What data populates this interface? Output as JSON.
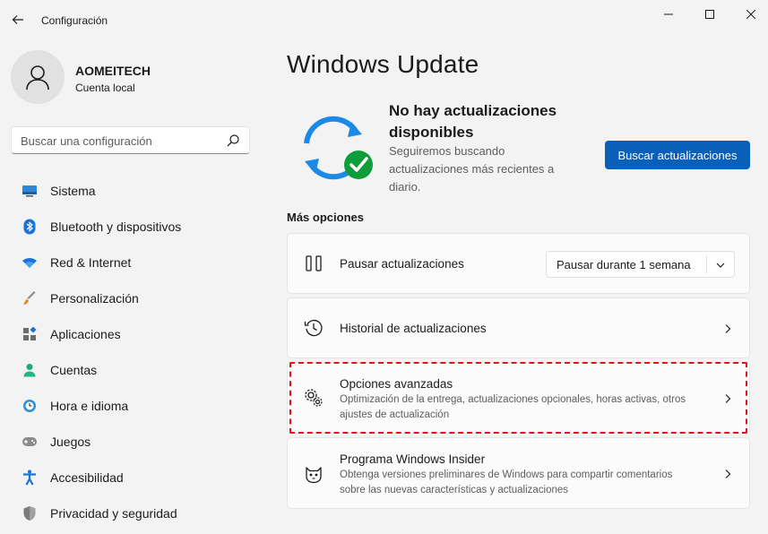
{
  "window": {
    "title": "Configuración"
  },
  "profile": {
    "name": "AOMEITECH",
    "account": "Cuenta local"
  },
  "search": {
    "placeholder": "Buscar una configuración"
  },
  "sidebar": {
    "items": [
      {
        "label": "Sistema",
        "icon": "system-icon"
      },
      {
        "label": "Bluetooth y dispositivos",
        "icon": "bluetooth-icon"
      },
      {
        "label": "Red & Internet",
        "icon": "wifi-icon"
      },
      {
        "label": "Personalización",
        "icon": "brush-icon"
      },
      {
        "label": "Aplicaciones",
        "icon": "apps-icon"
      },
      {
        "label": "Cuentas",
        "icon": "accounts-icon"
      },
      {
        "label": "Hora e idioma",
        "icon": "time-language-icon"
      },
      {
        "label": "Juegos",
        "icon": "gamepad-icon"
      },
      {
        "label": "Accesibilidad",
        "icon": "accessibility-icon"
      },
      {
        "label": "Privacidad y seguridad",
        "icon": "shield-icon"
      }
    ]
  },
  "main": {
    "title": "Windows Update",
    "status": {
      "title": "No hay actualizaciones disponibles",
      "subtitle": "Seguiremos buscando actualizaciones más recientes a diario."
    },
    "check_button": "Buscar actualizaciones",
    "section_label": "Más opciones",
    "options": {
      "pause": {
        "title": "Pausar actualizaciones",
        "dropdown_value": "Pausar durante 1 semana"
      },
      "history": {
        "title": "Historial de actualizaciones"
      },
      "advanced": {
        "title": "Opciones avanzadas",
        "subtitle": "Optimización de la entrega, actualizaciones opcionales, horas activas, otros ajustes de actualización"
      },
      "insider": {
        "title": "Programa Windows Insider",
        "subtitle": "Obtenga versiones preliminares de Windows para compartir comentarios sobre las nuevas características y actualizaciones"
      }
    }
  },
  "colors": {
    "accent": "#0a5fb8",
    "highlight": "#e0151c",
    "success": "#0f9d3b"
  }
}
